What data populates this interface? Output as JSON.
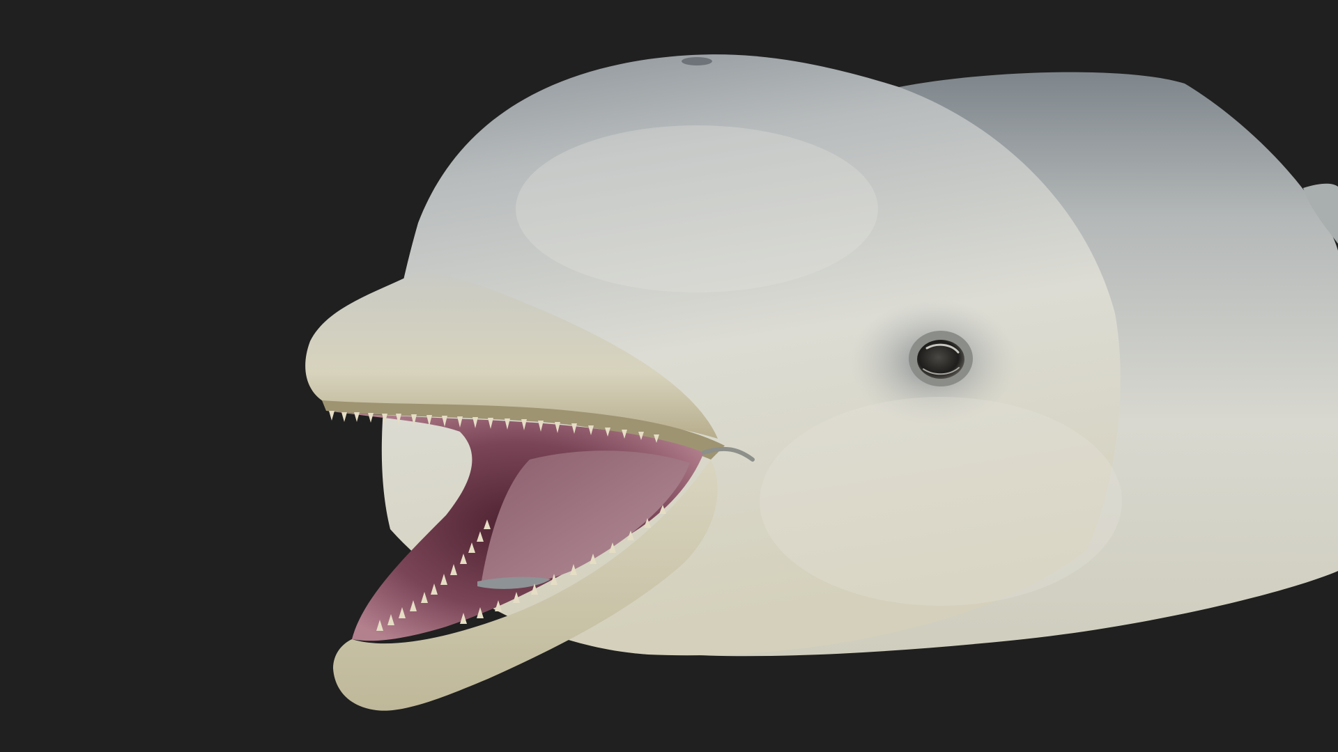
{
  "viewport": {
    "background_color": "#202020",
    "model_subject": "dolphin-head",
    "colors": {
      "skin_light": "#d9d9d2",
      "skin_mid": "#b9bcbb",
      "skin_dark": "#8f969b",
      "belly": "#d6d2bd",
      "mouth": "#6e3f4c",
      "tongue": "#a07a86",
      "teeth": "#e8dfc8",
      "eye": "#2e2e2c"
    }
  }
}
